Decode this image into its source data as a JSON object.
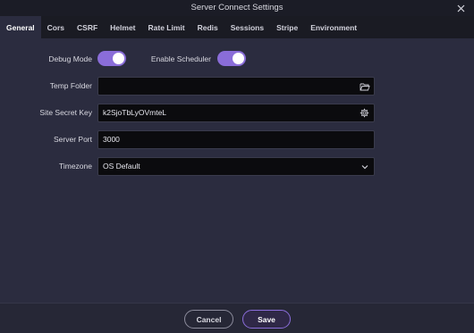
{
  "window": {
    "title": "Server Connect Settings"
  },
  "tabs": [
    {
      "label": "General"
    },
    {
      "label": "Cors"
    },
    {
      "label": "CSRF"
    },
    {
      "label": "Helmet"
    },
    {
      "label": "Rate Limit"
    },
    {
      "label": "Redis"
    },
    {
      "label": "Sessions"
    },
    {
      "label": "Stripe"
    },
    {
      "label": "Environment"
    }
  ],
  "active_tab": "General",
  "general": {
    "debug_mode": {
      "label": "Debug Mode",
      "enabled": true
    },
    "enable_scheduler": {
      "label": "Enable Scheduler",
      "enabled": true
    },
    "temp_folder": {
      "label": "Temp Folder",
      "value": ""
    },
    "site_secret_key": {
      "label": "Site Secret Key",
      "value": "k2SjoTbLyOVmteL"
    },
    "server_port": {
      "label": "Server Port",
      "value": "3000"
    },
    "timezone": {
      "label": "Timezone",
      "value": "OS Default"
    }
  },
  "footer": {
    "cancel_label": "Cancel",
    "save_label": "Save"
  },
  "icons": {
    "close": "close-icon",
    "folder": "folder-open-icon",
    "gear": "gear-icon",
    "chevron": "chevron-down-icon"
  },
  "colors": {
    "accent": "#8a6dd9",
    "background": "#2b2c3f",
    "tabbar": "#1a1b23",
    "field": "#0b0b0e"
  }
}
